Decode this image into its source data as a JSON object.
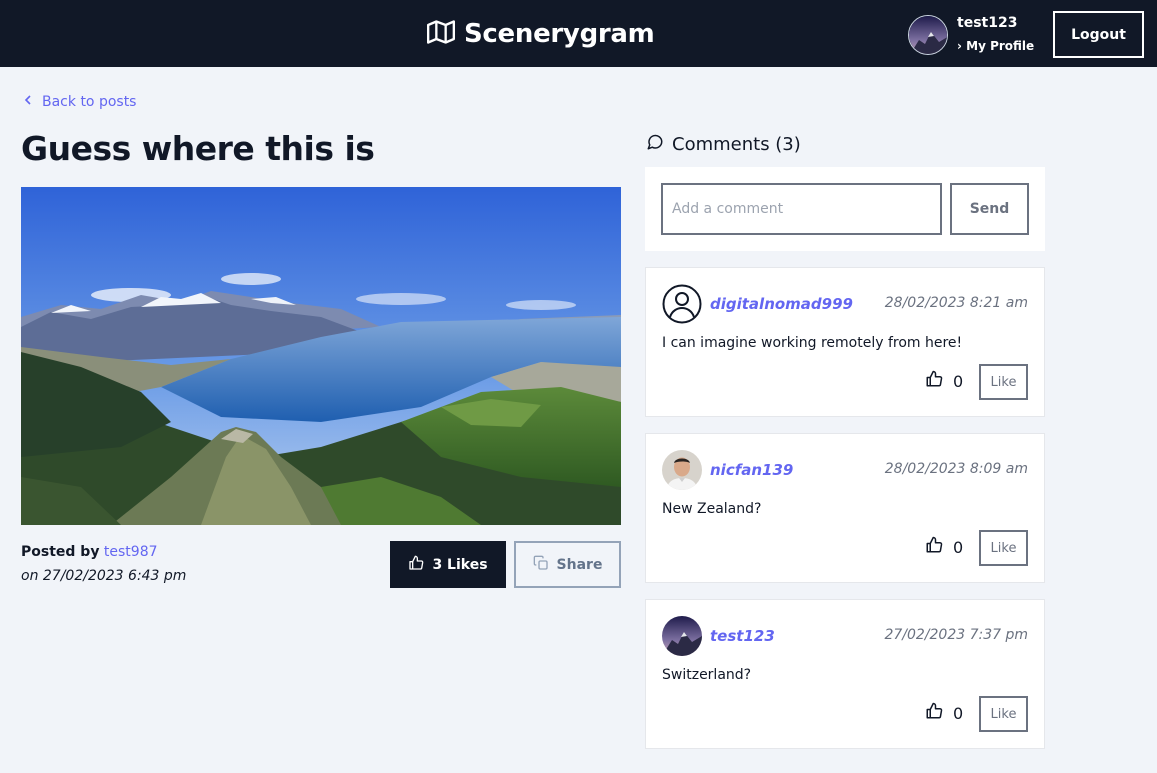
{
  "header": {
    "app_name": "Scenerygram",
    "user": {
      "username": "test123",
      "profile_link": "› My Profile"
    },
    "logout_label": "Logout"
  },
  "post": {
    "back_label": "Back to posts",
    "title": "Guess where this is",
    "posted_by_label": "Posted by",
    "author": "test987",
    "posted_on": "on 27/02/2023 6:43 pm",
    "likes_label": "3 Likes",
    "share_label": "Share"
  },
  "comments": {
    "heading": "Comments (3)",
    "input_placeholder": "Add a comment",
    "send_label": "Send",
    "items": [
      {
        "author": "digitalnomad999",
        "date": "28/02/2023 8:21 am",
        "text": "I can imagine working remotely from here!",
        "likes": "0",
        "like_label": "Like",
        "avatar": "default-user-icon"
      },
      {
        "author": "nicfan139",
        "date": "28/02/2023 8:09 am",
        "text": "New Zealand?",
        "likes": "0",
        "like_label": "Like",
        "avatar": "photo"
      },
      {
        "author": "test123",
        "date": "27/02/2023 7:37 pm",
        "text": "Switzerland?",
        "likes": "0",
        "like_label": "Like",
        "avatar": "mountain-photo"
      }
    ]
  },
  "colors": {
    "header_bg": "#111827",
    "accent": "#6366f1",
    "page_bg": "#f1f4f9"
  }
}
